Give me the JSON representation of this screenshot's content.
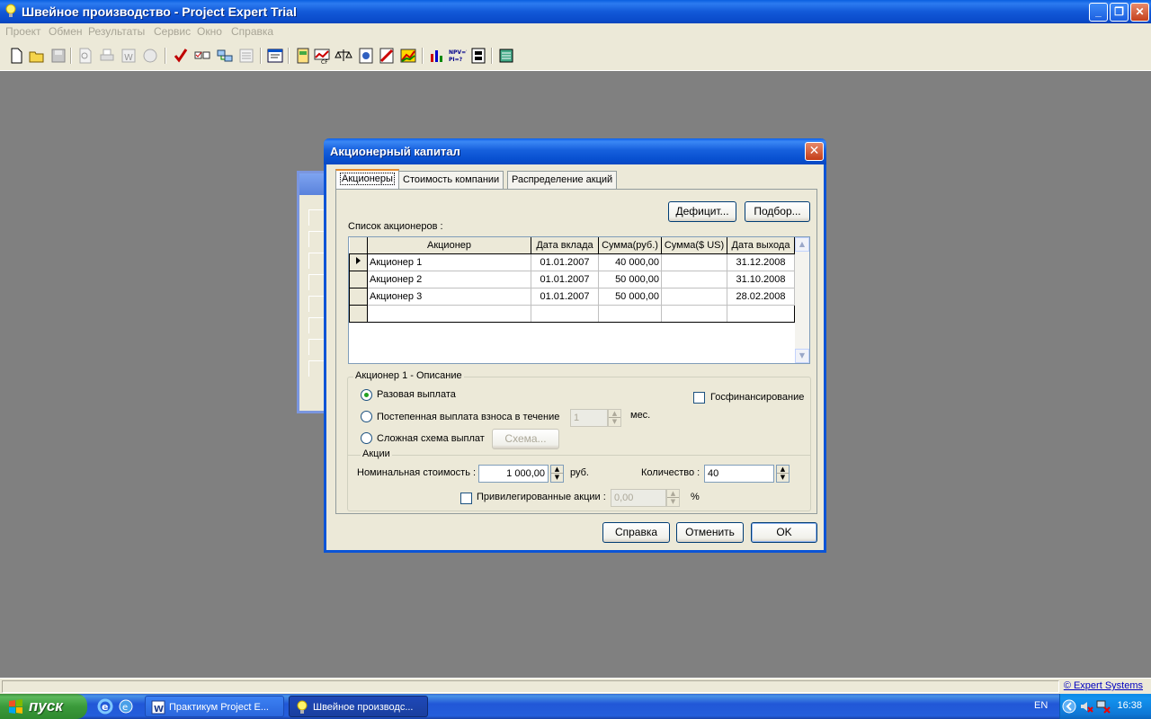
{
  "window": {
    "title": "Швейное производство - Project Expert Trial",
    "minimize": "_",
    "restore": "❐",
    "close": "✕"
  },
  "menu": [
    "Проект",
    "Обмен",
    "Результаты",
    "Сервис",
    "Окно",
    "Справка"
  ],
  "toolbar": {
    "icons": [
      "new-icon",
      "open-icon",
      "save-icon",
      "preview-icon",
      "print-icon",
      "export-word-icon",
      "export-icon",
      "check-icon",
      "compare-icon",
      "link-icon",
      "list-icon",
      "window-icon",
      "table-icon",
      "cashflow-icon",
      "balance-icon",
      "analysis-icon",
      "report-icon",
      "chart-icon",
      "bar-chart-icon",
      "npv-icon",
      "structure-icon",
      "calc-icon"
    ],
    "npv_label": "NPV=?\nPI=?"
  },
  "dialog": {
    "title": "Акционерный капитал",
    "close": "✕",
    "tabs": [
      "Акционеры",
      "Стоимость компании",
      "Распределение акций"
    ],
    "deficit_button": "Дефицит...",
    "select_button": "Подбор...",
    "list_label": "Список акционеров :",
    "grid": {
      "columns": [
        "Акционер",
        "Дата вклада",
        "Сумма(руб.)",
        "Сумма($ US)",
        "Дата выхода"
      ],
      "rows": [
        {
          "name": "Акционер 1",
          "date_in": "01.01.2007",
          "sum_rub": "40 000,00",
          "sum_usd": "",
          "date_out": "31.12.2008"
        },
        {
          "name": "Акционер 2",
          "date_in": "01.01.2007",
          "sum_rub": "50 000,00",
          "sum_usd": "",
          "date_out": "31.10.2008"
        },
        {
          "name": "Акционер 3",
          "date_in": "01.01.2007",
          "sum_rub": "50 000,00",
          "sum_usd": "",
          "date_out": "28.02.2008"
        }
      ]
    },
    "description_legend": "Акционер 1 - Описание",
    "radio_once": "Разовая выплата",
    "radio_gradual": "Постепенная выплата взноса  в течение",
    "gradual_months": "1",
    "months_unit": "мес.",
    "radio_complex": "Сложная схема выплат",
    "scheme_button": "Схема...",
    "gov_funding": "Госфинансирование",
    "shares_legend": "Акции",
    "nominal_label": "Номинальная стоимость :",
    "nominal_value": "1 000,00",
    "nominal_unit": "руб.",
    "qty_label": "Количество :",
    "qty_value": "40",
    "preferred_label": "Привилегированные акции :",
    "preferred_value": "0,00",
    "preferred_unit": "%",
    "help_button": "Справка",
    "cancel_button": "Отменить",
    "ok_button": "OK"
  },
  "statusbar": {
    "link": "© Expert Systems"
  },
  "taskbar": {
    "start": "пуск",
    "tasks": [
      "Практикум Project E...",
      "Швейное производс..."
    ],
    "lang": "EN",
    "clock": "16:38"
  }
}
